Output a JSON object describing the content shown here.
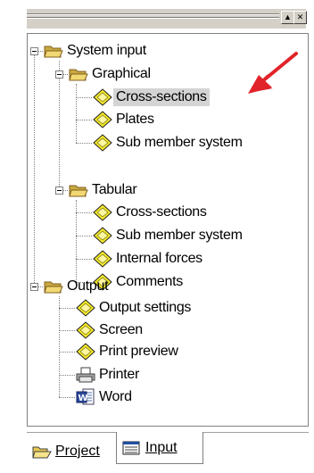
{
  "tree": {
    "system_input": "System input",
    "graphical": "Graphical",
    "graphical_items": [
      "Cross-sections",
      "Plates",
      "Sub member system"
    ],
    "tabular": "Tabular",
    "tabular_items": [
      "Cross-sections",
      "Sub member system",
      "Internal forces",
      "Comments"
    ],
    "output": "Output",
    "output_items": [
      "Output settings",
      "Screen",
      "Print preview",
      "Printer",
      "Word"
    ]
  },
  "tabs": {
    "project": "Project",
    "input": "Input"
  },
  "colors": {
    "selection": "#d4d4d4",
    "arrow": "#e0242a",
    "folder": "#f2d873",
    "diamond": "#f6e92a"
  }
}
